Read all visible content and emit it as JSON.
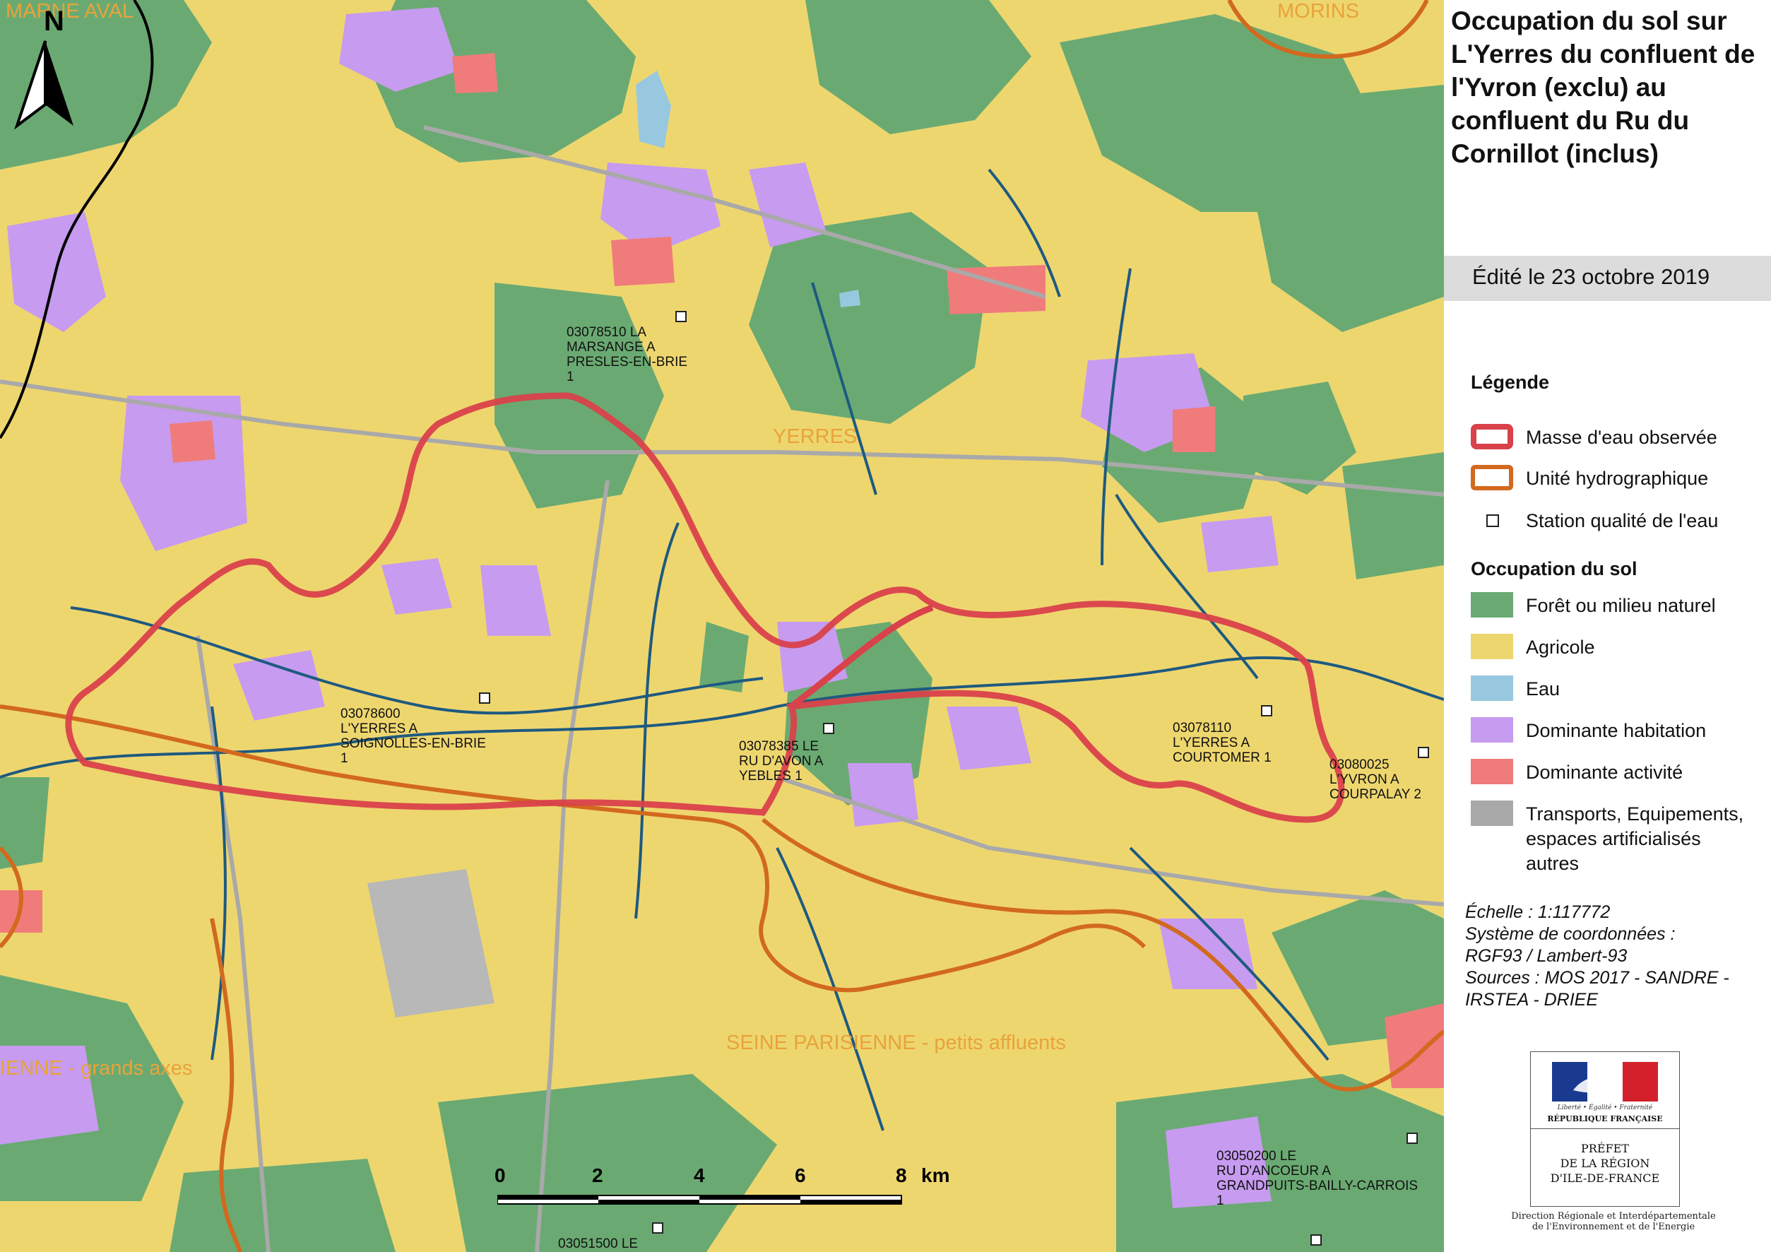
{
  "map": {
    "stations": [
      {
        "id": "s1",
        "lines": "03078510   LA\nMARSANGE A\nPRESLES-EN-BRIE\n1"
      },
      {
        "id": "s2",
        "lines": "03078600\nL'YERRES A\nSOIGNOLLES-EN-BRIE\n1"
      },
      {
        "id": "s3",
        "lines": "03078385   LE\nRU D'AVON A\nYEBLES 1"
      },
      {
        "id": "s4",
        "lines": "03078110\nL'YERRES A\nCOURTOMER 1"
      },
      {
        "id": "s5",
        "lines": "03080025\nL'YVRON A\nCOURPALAY 2"
      },
      {
        "id": "s6",
        "lines": "03050200   LE\nRU D'ANCOEUR A\nGRANDPUITS-BAILLY-CARROIS\n1"
      },
      {
        "id": "s7",
        "lines": "03051500   LE"
      }
    ],
    "zones": {
      "yerres": "YERRES",
      "seine_petits": "SEINE PARISIENNE - petits affluents",
      "seine_grands": "IENNE - grands axes",
      "marne": "MARNE AVAL",
      "morins": "MORINS"
    },
    "north": "N",
    "scale": {
      "ticks": [
        "0",
        "2",
        "4",
        "6",
        "8"
      ],
      "unit": "km"
    }
  },
  "panel": {
    "title": "Occupation du sol sur L'Yerres du confluent de l'Yvron (exclu) au confluent du Ru du Cornillot (inclus)",
    "edited": "Édité le 23 octobre 2019",
    "legend_title": "Légende",
    "legend_lines": [
      {
        "label": "Masse d'eau observée",
        "color": "#d9414b"
      },
      {
        "label": "Unité hydrographique",
        "color": "#d2691e"
      },
      {
        "label": "Station qualité de l'eau",
        "color": "#ffffff"
      }
    ],
    "landuse_title": "Occupation du sol",
    "landuse": [
      {
        "label": "Forêt ou milieu naturel",
        "color": "#6aaa72"
      },
      {
        "label": "Agricole",
        "color": "#eed66f"
      },
      {
        "label": "Eau",
        "color": "#98c8e0"
      },
      {
        "label": "Dominante habitation",
        "color": "#c79bf0"
      },
      {
        "label": "Dominante activité",
        "color": "#f07b7b"
      },
      {
        "label": "Transports, Equipements, espaces artificialisés\n autres",
        "color": "#a9a9a9"
      }
    ],
    "meta": [
      "Échelle :  1:117772",
      "Système de coordonnées :",
      "RGF93 / Lambert-93",
      "Sources : MOS 2017 - SANDRE -",
      "IRSTEA - DRIEE"
    ],
    "logo": {
      "motto": "Liberté • Égalité • Fraternité",
      "republic": "RÉPUBLIQUE FRANÇAISE",
      "prefet": "PRÉFET\nDE LA RÉGION\nD'ILE-DE-FRANCE",
      "direction": "Direction Régionale et Interdépartementale\nde l'Environnement et de l'Energie"
    }
  }
}
